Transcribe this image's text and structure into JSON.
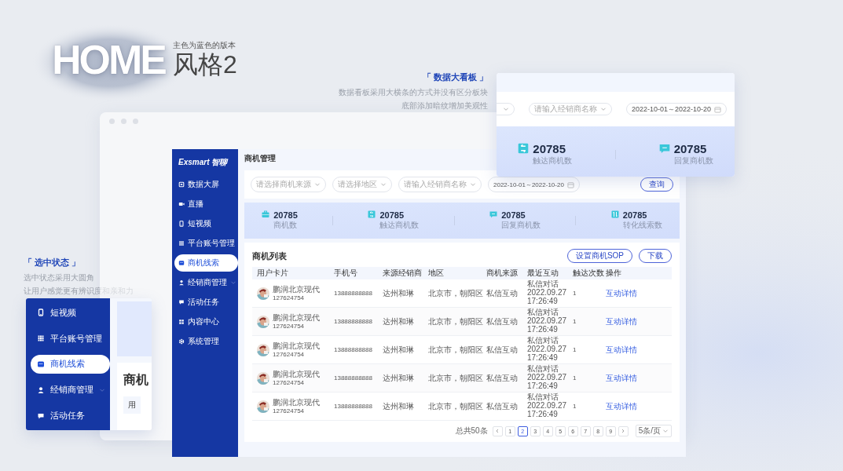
{
  "heading": {
    "title": "HOME",
    "subtitle": "主色为蓝色的版本",
    "version": "风格2"
  },
  "dashboard_note": {
    "title": "「 数据大看板 」",
    "lines": [
      "数据看板采用大横条的方式并没有区分板块",
      "底部添加暗纹增加美观性"
    ]
  },
  "selection_note": {
    "title": "「 选中状态 」",
    "lines": [
      "选中状态采用大圆角",
      "让用户感觉更有辨识度和亲和力"
    ]
  },
  "app": {
    "logo": "Exsmart 智聊",
    "sidebar": [
      {
        "label": "数据大屏",
        "selected": false,
        "expandable": false
      },
      {
        "label": "直播",
        "selected": false,
        "expandable": false
      },
      {
        "label": "短视频",
        "selected": false,
        "expandable": false
      },
      {
        "label": "平台账号管理",
        "selected": false,
        "expandable": false
      },
      {
        "label": "商机线索",
        "selected": true,
        "expandable": false
      },
      {
        "label": "经销商管理",
        "selected": false,
        "expandable": true
      },
      {
        "label": "活动任务",
        "selected": false,
        "expandable": false
      },
      {
        "label": "内容中心",
        "selected": false,
        "expandable": false
      },
      {
        "label": "系统管理",
        "selected": false,
        "expandable": false
      }
    ],
    "page_title": "商机管理",
    "filters": [
      {
        "kind": "select",
        "placeholder": "请选择商机来源"
      },
      {
        "kind": "select",
        "placeholder": "请选择地区"
      },
      {
        "kind": "select",
        "placeholder": "请输入经销商名称"
      },
      {
        "kind": "date",
        "value": "2022-10-01～2022-10-20"
      }
    ],
    "query_button": "查询",
    "stats": [
      {
        "value": "20785",
        "label": "商机数"
      },
      {
        "value": "20785",
        "label": "触达商机数"
      },
      {
        "value": "20785",
        "label": "回复商机数"
      },
      {
        "value": "20785",
        "label": "转化线索数"
      }
    ],
    "list_title": "商机列表",
    "actions": [
      "设置商机SOP",
      "下载"
    ],
    "columns": [
      "用户卡片",
      "手机号",
      "来源经销商",
      "地区",
      "商机来源",
      "最近互动",
      "触达次数",
      "操作"
    ],
    "rows": [
      {
        "name": "鹏润北京现代",
        "id": "127624754",
        "phone": "13888888888",
        "dealer": "达州和琳",
        "region": "北京市，朝阳区",
        "source": "私信互动",
        "interaction": [
          "私信对话",
          "2022.09.27",
          "17:26:49"
        ],
        "count": "1",
        "action": "互动详情"
      },
      {
        "name": "鹏润北京现代",
        "id": "127624754",
        "phone": "13888888888",
        "dealer": "达州和琳",
        "region": "北京市，朝阳区",
        "source": "私信互动",
        "interaction": [
          "私信对话",
          "2022.09.27",
          "17:26:49"
        ],
        "count": "1",
        "action": "互动详情"
      },
      {
        "name": "鹏润北京现代",
        "id": "127624754",
        "phone": "13888888888",
        "dealer": "达州和琳",
        "region": "北京市，朝阳区",
        "source": "私信互动",
        "interaction": [
          "私信对话",
          "2022.09.27",
          "17:26:49"
        ],
        "count": "1",
        "action": "互动详情"
      },
      {
        "name": "鹏润北京现代",
        "id": "127624754",
        "phone": "13888888888",
        "dealer": "达州和琳",
        "region": "北京市，朝阳区",
        "source": "私信互动",
        "interaction": [
          "私信对话",
          "2022.09.27",
          "17:26:49"
        ],
        "count": "1",
        "action": "互动详情"
      },
      {
        "name": "鹏润北京现代",
        "id": "127624754",
        "phone": "13888888888",
        "dealer": "达州和琳",
        "region": "北京市，朝阳区",
        "source": "私信互动",
        "interaction": [
          "私信对话",
          "2022.09.27",
          "17:26:49"
        ],
        "count": "1",
        "action": "互动详情"
      }
    ],
    "pagination": {
      "total": "总共50条",
      "pages": [
        {
          "label": "1",
          "selected": false
        },
        {
          "label": "2",
          "selected": true
        },
        {
          "label": "3",
          "selected": false
        },
        {
          "label": "4",
          "selected": false
        },
        {
          "label": "5",
          "selected": false
        },
        {
          "label": "6",
          "selected": false
        },
        {
          "label": "7",
          "selected": false
        },
        {
          "label": "8",
          "selected": false
        },
        {
          "label": "9",
          "selected": false
        }
      ],
      "page_size": "5条/页"
    }
  },
  "dashboard_zoom": {
    "filters": [
      {
        "kind": "select"
      },
      {
        "kind": "select",
        "placeholder": "请输入经销商名称"
      },
      {
        "kind": "date",
        "value": "2022-10-01～2022-10-20"
      }
    ],
    "stats": [
      {
        "value": "20785",
        "label": "触达商机数"
      },
      {
        "value": "20785",
        "label": "回复商机数"
      }
    ]
  },
  "selection_zoom": {
    "sidebar": [
      {
        "label": "短视频",
        "selected": false,
        "expandable": false
      },
      {
        "label": "平台账号管理",
        "selected": false,
        "expandable": false
      },
      {
        "label": "商机线索",
        "selected": true,
        "expandable": false
      },
      {
        "label": "经销商管理",
        "selected": false,
        "expandable": true
      },
      {
        "label": "活动任务",
        "selected": false,
        "expandable": false
      }
    ],
    "page_title": "商机",
    "column": "用"
  }
}
